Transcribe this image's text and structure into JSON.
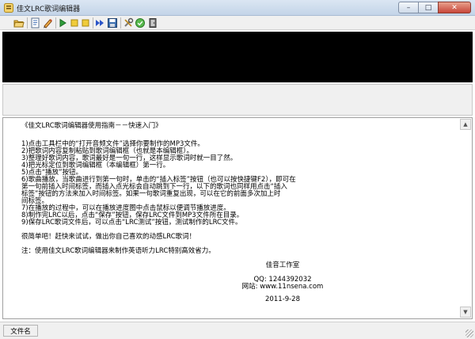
{
  "window": {
    "title": "佳文LRC歌词编辑器",
    "controls": {
      "minimize": "–",
      "maximize": "□",
      "close": "✕"
    }
  },
  "toolbar": {
    "buttons": [
      {
        "icon": "open-folder-icon",
        "color": "#d6a437"
      },
      {
        "icon": "edit-lyrics-icon",
        "color": "#4a76b8"
      },
      {
        "icon": "pencil-icon",
        "color": "#c94b2c"
      },
      {
        "icon": "play-icon",
        "color": "#2e9d3a"
      },
      {
        "icon": "pause-icon",
        "color": "#e8c33a"
      },
      {
        "icon": "stop-icon",
        "color": "#e8c33a"
      },
      {
        "icon": "fast-forward-icon",
        "color": "#2c55c8"
      },
      {
        "icon": "save-icon",
        "color": "#3c6fb0"
      },
      {
        "icon": "tools-icon",
        "color": "#7a7a7a"
      },
      {
        "icon": "test-icon",
        "color": "#3fa23f"
      },
      {
        "icon": "exit-icon",
        "color": "#555555"
      }
    ]
  },
  "editor": {
    "heading": "《佳文LRC歌词编辑器使用指南－－快速入门》",
    "steps": [
      "1)点击工具栏中的“打开音频文件”选择你要制作的MP3文件。",
      "2)把歌词内容复制粘贴到歌词编辑框（也就是本编辑框）。",
      "3)整理好歌词内容，歌词最好是一句一行，这样显示歌词时就一目了然。",
      "4)把光标定位到歌词编辑框（本编辑框）第一行。",
      "5)点击“播放”按钮。",
      "6)歌曲播放，当歌曲进行到第一句时，单击的“插入标签”按钮（也可以按快捷键F2），即可在",
      "   第一句前插入时间标签，而插入点光标会自动跳到下一行，以下的歌词也同样用点击“插入",
      "   标签”按钮的方法来加入时间标签。如果一句歌词重复出现，可以在它的前面多次加上时",
      "   间标签。",
      "7)在播放的过程中，可以在播放进度图中点击鼠标以便调节播放进度。",
      "8)制作完LRC以后，点击“保存”按钮，保存LRC文件到MP3文件所在目录。",
      "9)保存LRC歌词文件后，可以点击“LRC测试”按钮，测试制作的LRC文件。"
    ],
    "closing": "很简单吧！赶快来试试，做出你自己喜欢的动感LRC歌词！",
    "note": "注：使用佳文LRC歌词编辑器来制作英语听力LRC特别高效省力。",
    "studio": "佳音工作室",
    "qq": "QQ: 1244392032",
    "website": "网站: www.11nsena.com",
    "date": "2011-9-28"
  },
  "scrollbar": {
    "up": "▲",
    "down": "▼"
  },
  "statusbar": {
    "file_label": "文件名"
  }
}
